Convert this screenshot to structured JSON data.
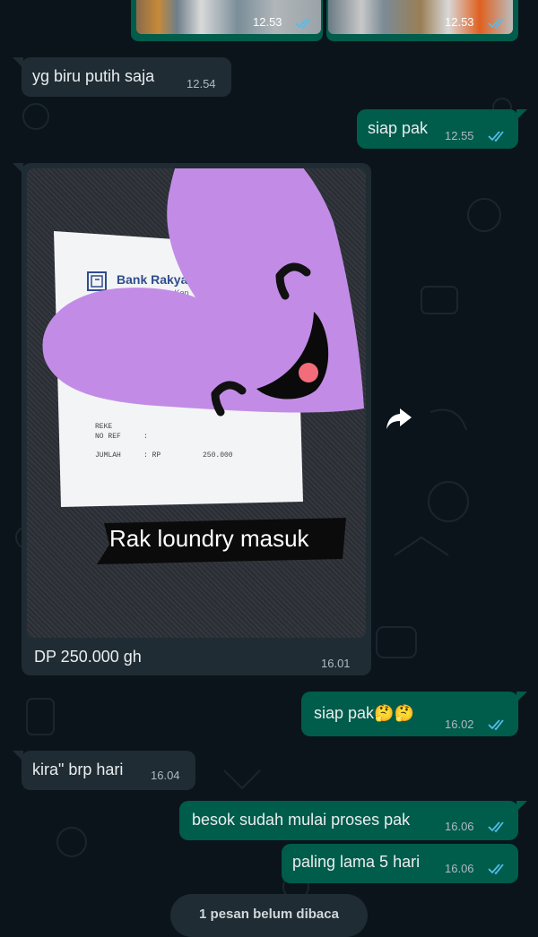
{
  "chat": {
    "photos_top": [
      {
        "time": "12.53"
      },
      {
        "time": "12.53"
      }
    ],
    "messages": [
      {
        "text": "yg biru putih saja",
        "time": "12.54"
      },
      {
        "text": "siap pak",
        "time": "12.55"
      },
      {
        "caption": "DP 250.000 gh",
        "time": "16.01"
      },
      {
        "text": "siap pak🤔🤔",
        "time": "16.02"
      },
      {
        "text": "kira\" brp hari",
        "time": "16.04"
      },
      {
        "text": "besok sudah mulai proses pak",
        "time": "16.06"
      },
      {
        "text": "paling lama 5 hari",
        "time": "16.06"
      }
    ],
    "receipt": {
      "bank_name": "Bank Rakya",
      "tagline": "Mengutamakan Kep",
      "ref_label": "NO REF",
      "rek_label": "REKE",
      "sep": ":",
      "amount_label": "JUMLAH",
      "currency": ": RP",
      "amount": "250.000",
      "sticker_text": "Rak loundry masuk"
    },
    "unread_banner": "1 pesan belum dibaca"
  },
  "icons": {
    "read_ticks": "double-check-icon",
    "forward": "forward-arrow-icon",
    "sticker": "smiling-heart-sticker"
  },
  "colors": {
    "background": "#0b141a",
    "incoming": "#202c33",
    "outgoing": "#005c4b",
    "tick_read": "#53bdeb",
    "sticker": "#c28ce6"
  }
}
